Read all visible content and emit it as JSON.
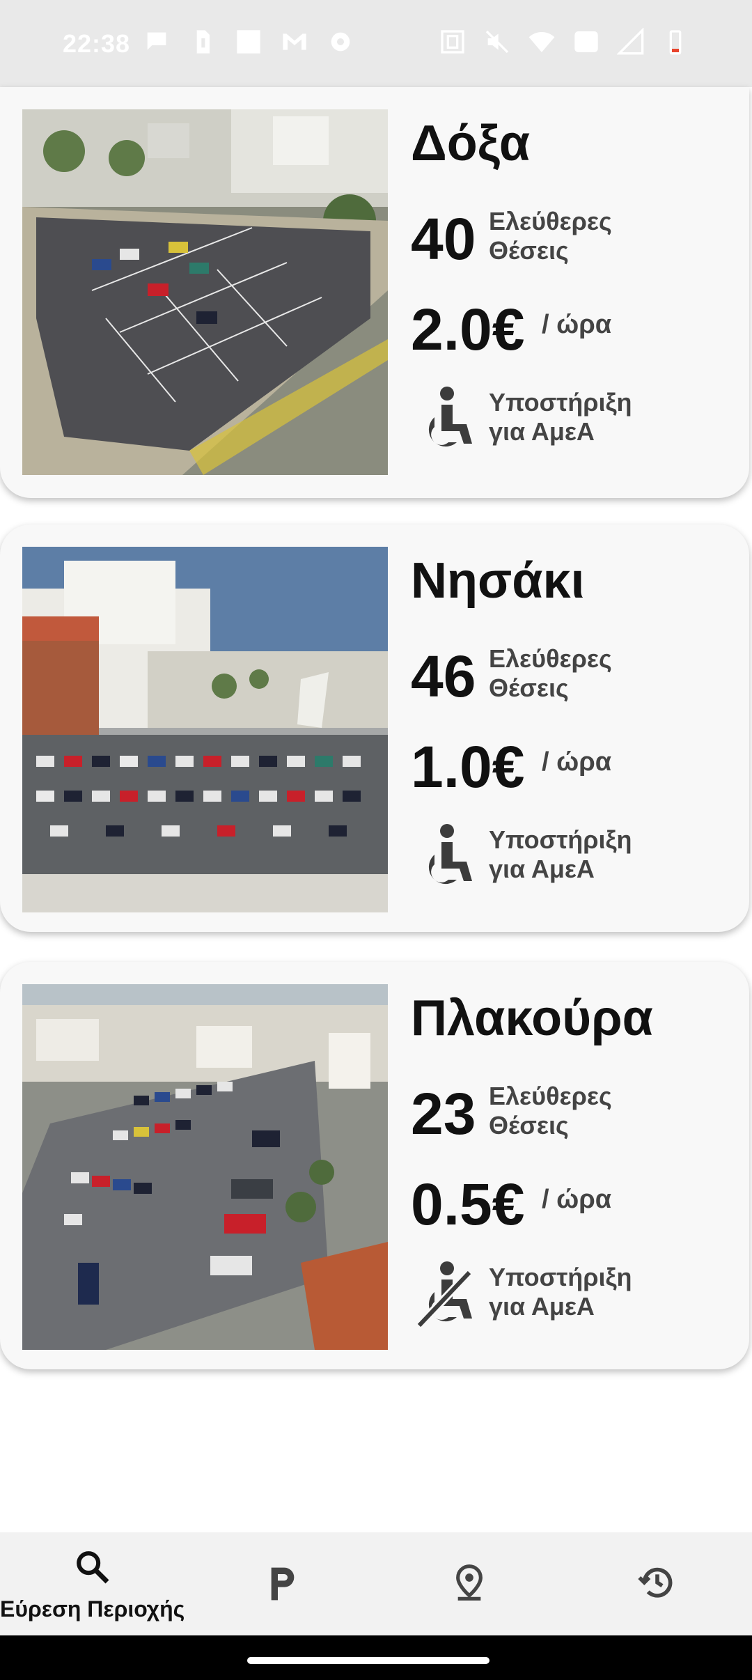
{
  "status_bar": {
    "time": "22:38"
  },
  "parkings": [
    {
      "name": "Δόξα",
      "free_spots": "40",
      "free_spots_label": "Ελεύθερες Θέσεις",
      "price": "2.0€",
      "price_unit": "/ ώρα",
      "accessibility_label": "Υποστήριξη για ΑμεΑ",
      "accessible": true
    },
    {
      "name": "Νησάκι",
      "free_spots": "46",
      "free_spots_label": "Ελεύθερες Θέσεις",
      "price": "1.0€",
      "price_unit": "/ ώρα",
      "accessibility_label": "Υποστήριξη για ΑμεΑ",
      "accessible": true
    },
    {
      "name": "Πλακούρα",
      "free_spots": "23",
      "free_spots_label": "Ελεύθερες Θέσεις",
      "price": "0.5€",
      "price_unit": "/ ώρα",
      "accessibility_label": "Υποστήριξη για ΑμεΑ",
      "accessible": false
    }
  ],
  "bottom_nav": {
    "items": [
      {
        "icon": "search-icon",
        "label": "Εύρεση Περιοχής",
        "active": true
      },
      {
        "icon": "parking-icon",
        "label": "",
        "active": false
      },
      {
        "icon": "location-pin-icon",
        "label": "",
        "active": false
      },
      {
        "icon": "history-icon",
        "label": "",
        "active": false
      }
    ]
  },
  "colors": {
    "card_bg": "#f8f8f8",
    "text_primary": "#111111",
    "text_secondary": "#444444",
    "nav_bg": "#f2f2f2",
    "status_bar_bg": "#e9e9e9"
  }
}
